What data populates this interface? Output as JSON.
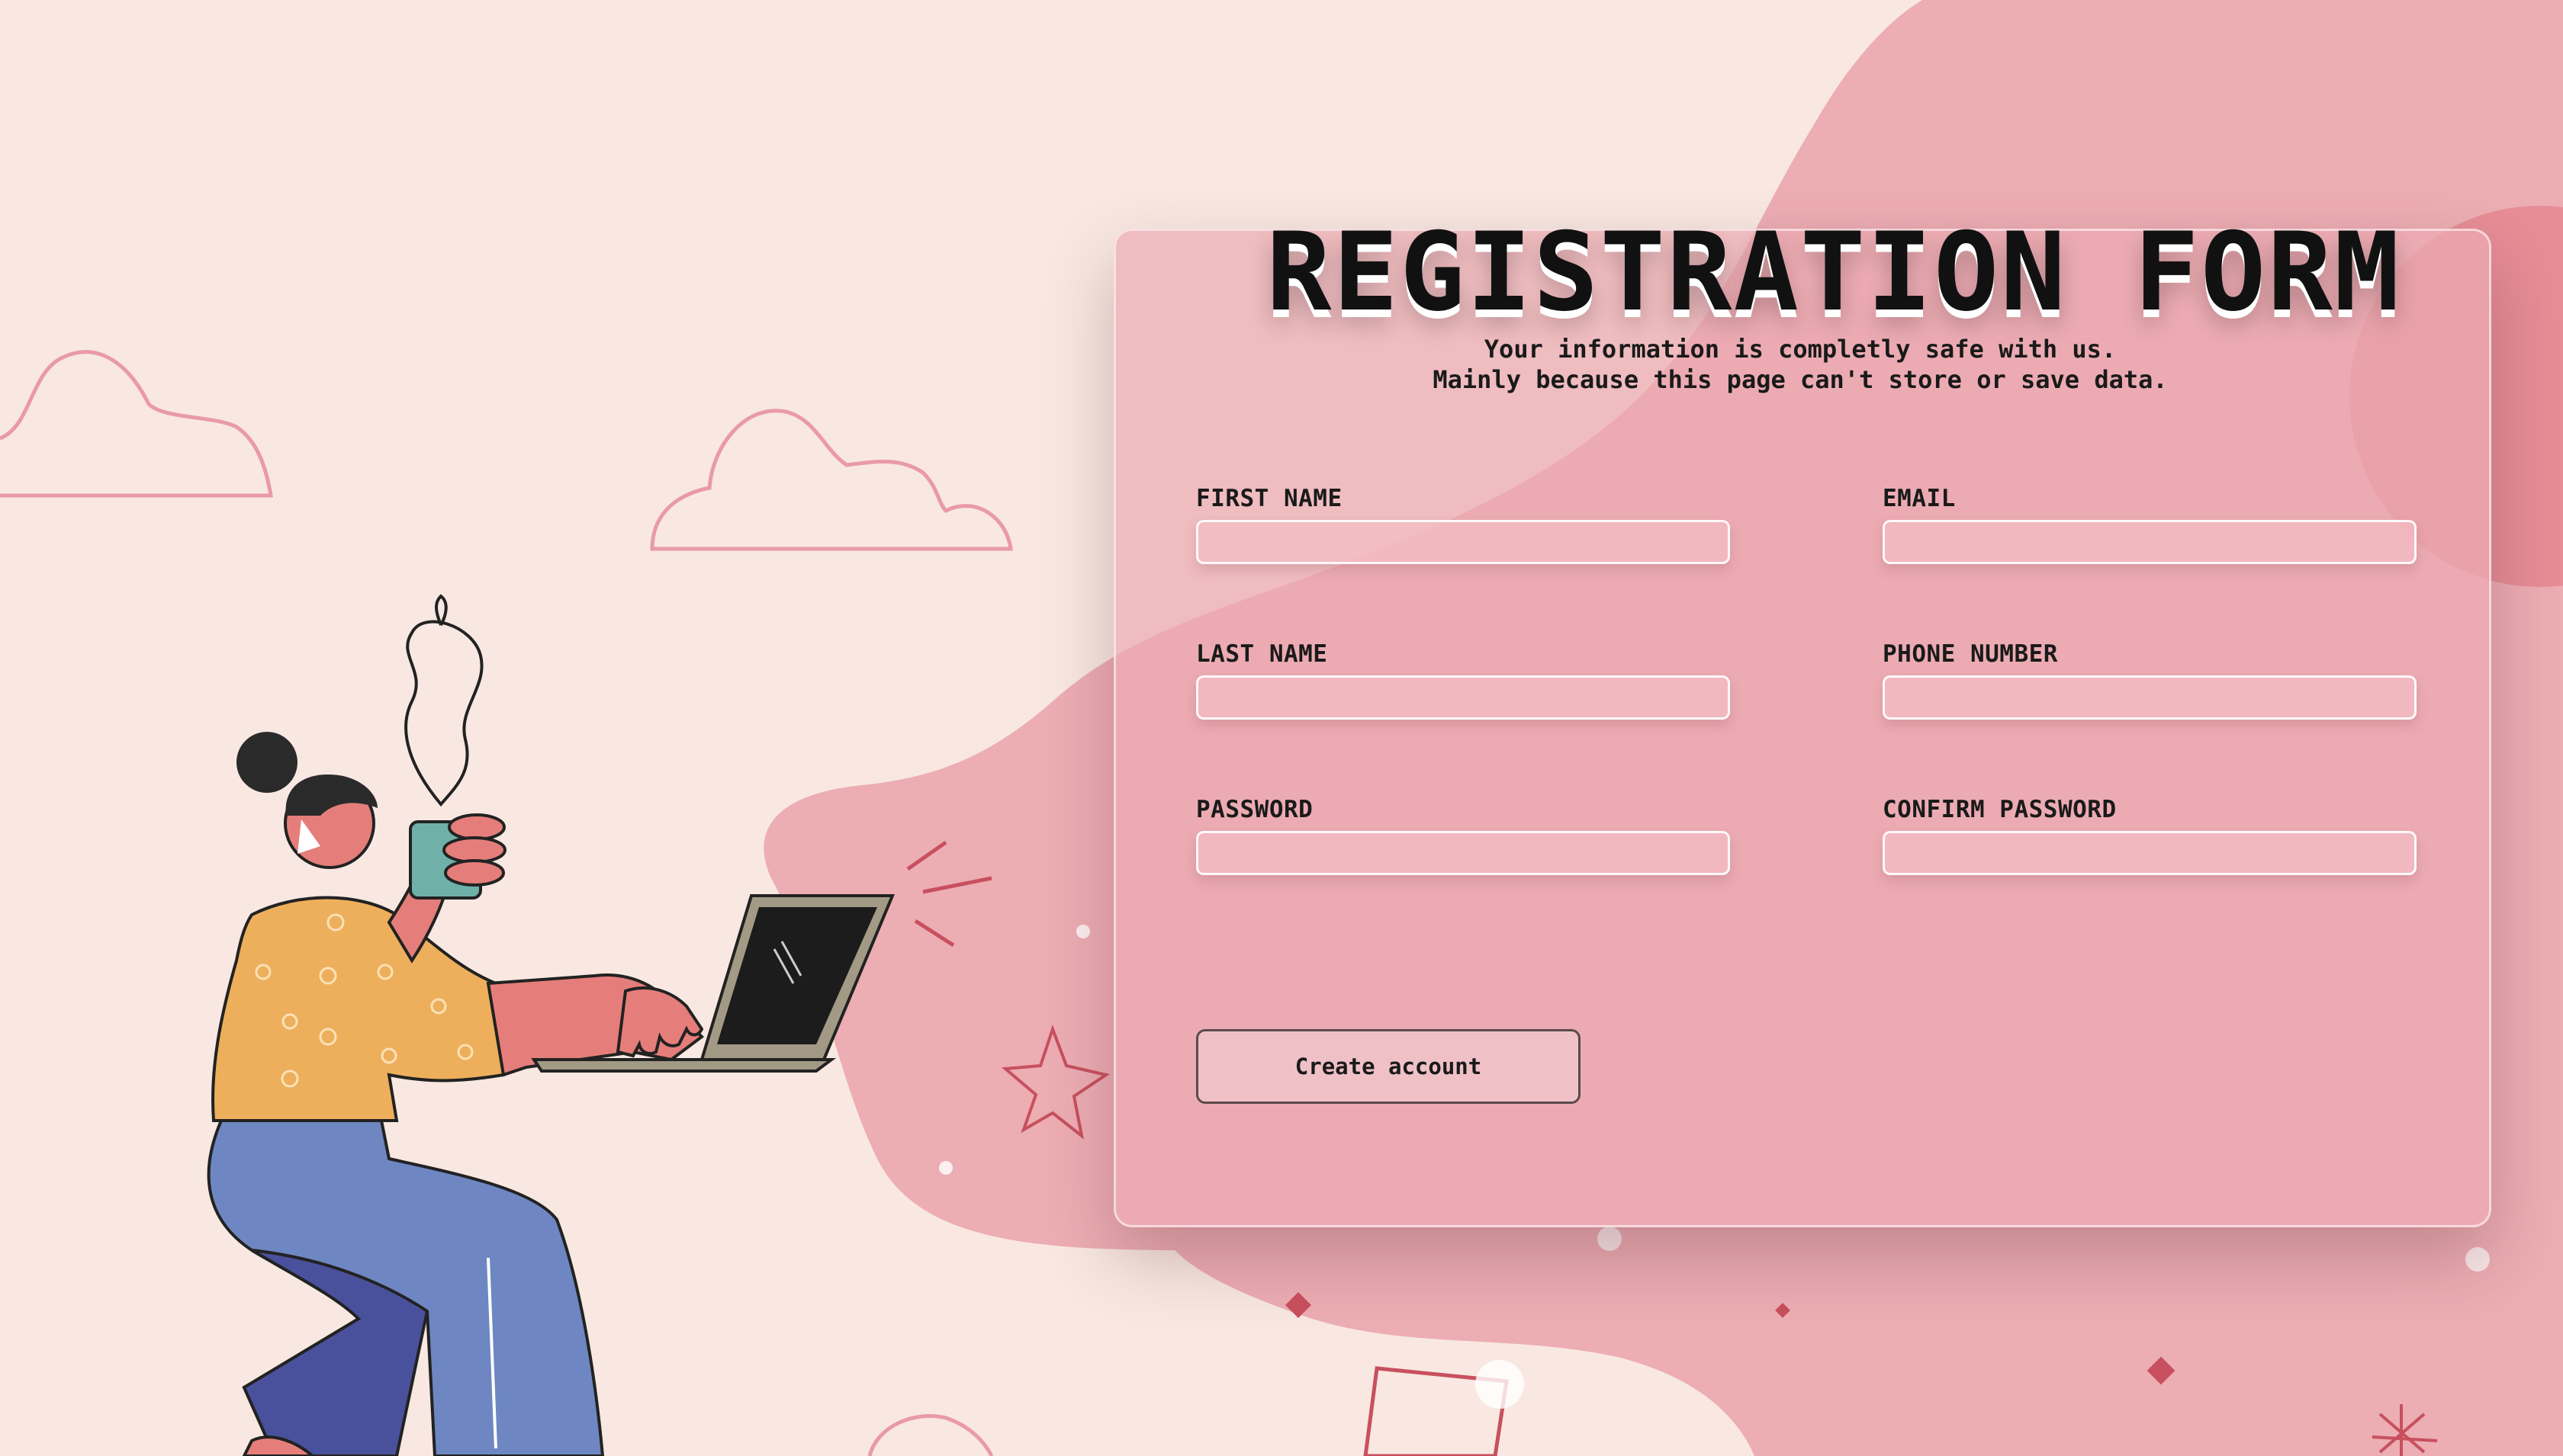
{
  "page": {
    "title": "REGISTRATION FORM",
    "subtitle_line1": "Your information is completly safe with us.",
    "subtitle_line2": "Mainly because this page can't store or save data."
  },
  "form": {
    "fields": [
      {
        "label": "FIRST NAME",
        "value": "",
        "placeholder": ""
      },
      {
        "label": "EMAIL",
        "value": "",
        "placeholder": ""
      },
      {
        "label": "LAST NAME",
        "value": "",
        "placeholder": ""
      },
      {
        "label": "PHONE NUMBER",
        "value": "",
        "placeholder": ""
      },
      {
        "label": "PASSWORD",
        "value": "",
        "placeholder": ""
      },
      {
        "label": "CONFIRM PASSWORD",
        "value": "",
        "placeholder": ""
      }
    ],
    "submit_label": "Create account"
  },
  "colors": {
    "background": "#f8e8e1",
    "blob": "#ecadb3",
    "card": "#eeadb4",
    "accent": "#c8505e",
    "text": "#111111"
  },
  "illustration": {
    "subject": "woman-with-laptop-and-coffee-illustration"
  }
}
